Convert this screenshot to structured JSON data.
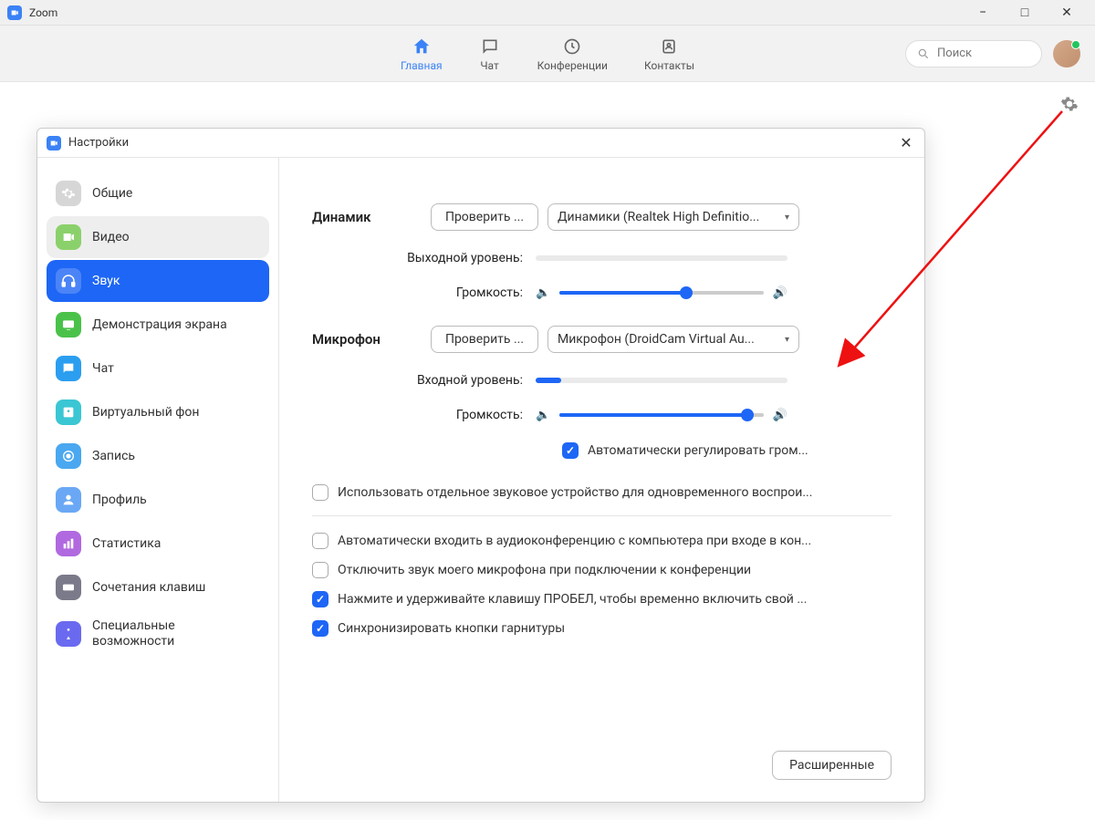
{
  "window": {
    "title": "Zoom"
  },
  "nav": {
    "home": "Главная",
    "chat": "Чат",
    "meetings": "Конференции",
    "contacts": "Контакты"
  },
  "search": {
    "placeholder": "Поиск"
  },
  "modal": {
    "title": "Настройки"
  },
  "sidebar": {
    "general": "Общие",
    "video": "Видео",
    "audio": "Звук",
    "share": "Демонстрация экрана",
    "chat": "Чат",
    "virtual_bg": "Виртуальный фон",
    "recording": "Запись",
    "profile": "Профиль",
    "stats": "Статистика",
    "shortcuts": "Сочетания клавиш",
    "accessibility": "Специальные возможности"
  },
  "audio": {
    "speaker_label": "Динамик",
    "microphone_label": "Микрофон",
    "test_btn": "Проверить ...",
    "speaker_device": "Динамики (Realtek High Definitio...",
    "mic_device": "Микрофон (DroidCam Virtual Au...",
    "output_level_label": "Выходной уровень:",
    "input_level_label": "Входной уровень:",
    "volume_label": "Громкость:",
    "input_level_pct": 10,
    "speaker_volume_pct": 62,
    "mic_volume_pct": 92,
    "auto_adjust": "Автоматически регулировать гром...",
    "opt_separate_device": "Использовать отдельное звуковое устройство для одновременного воспрои...",
    "opt_auto_join": "Автоматически входить в аудиоконференцию с компьютера при входе в кон...",
    "opt_mute_mic": "Отключить звук моего микрофона при подключении к конференции",
    "opt_spacebar": "Нажмите и удерживайте клавишу ПРОБЕЛ, чтобы временно включить свой ...",
    "opt_headset": "Синхронизировать кнопки гарнитуры",
    "advanced_btn": "Расширенные"
  }
}
